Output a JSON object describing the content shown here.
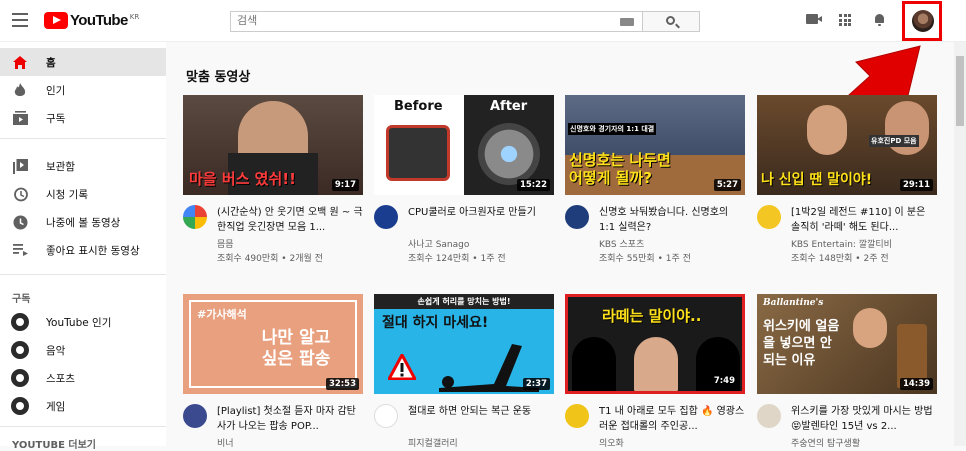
{
  "header": {
    "logo_text": "YouTube",
    "logo_region": "KR",
    "search_placeholder": "검색",
    "menu_icon": "hamburger-menu-icon",
    "icons": [
      "video-camera-icon",
      "apps-grid-icon",
      "notification-bell-icon"
    ]
  },
  "sidebar": {
    "primary": [
      {
        "label": "홈",
        "icon": "home-icon",
        "active": true
      },
      {
        "label": "인기",
        "icon": "trending-flame-icon"
      },
      {
        "label": "구독",
        "icon": "subscriptions-icon"
      }
    ],
    "library": [
      {
        "label": "보관함",
        "icon": "library-icon"
      },
      {
        "label": "시청 기록",
        "icon": "history-icon"
      },
      {
        "label": "나중에 볼 동영상",
        "icon": "watch-later-clock-icon"
      },
      {
        "label": "좋아요 표시한 동영상",
        "icon": "liked-videos-icon"
      }
    ],
    "subscriptions_heading": "구독",
    "subscriptions": [
      {
        "label": "YouTube 인기"
      },
      {
        "label": "음악"
      },
      {
        "label": "스포츠"
      },
      {
        "label": "게임"
      }
    ],
    "more_heading": "YOUTUBE 더보기"
  },
  "main": {
    "section_title": "맞춤 동영상",
    "videos": [
      {
        "thumb_text": "마을 버스 였쉬!!",
        "duration": "9:17",
        "title": "(시간순삭) 안 웃기면 오백 원 ~ 극한직업 웃긴장면 모음 1...",
        "channel": "믐믐",
        "meta": "조회수 490만회 • 2개월 전",
        "thumb_bg": "#3b2a24",
        "avatar_color": "#0f9d58"
      },
      {
        "thumb_text_left": "Before",
        "thumb_text_right": "After",
        "duration": "15:22",
        "title": "CPU쿨러로 아크원자로 만들기",
        "channel": "사나고 Sanago",
        "meta": "조회수 124만회 • 1주 전",
        "thumb_bg": "#ffffff",
        "avatar_color": "#1a3d8f"
      },
      {
        "thumb_text": "신명호는 나두면 어떻게 될까?",
        "thumb_caption": "신명호와 경기자의 1:1 대결",
        "duration": "5:27",
        "title": "신명호 놔둬봤습니다. 신명호의 1:1 실력은?",
        "channel": "KBS 스포츠",
        "meta": "조회수 55만회 • 1주 전",
        "thumb_bg": "#2b3a57",
        "avatar_color": "#1f3d7a"
      },
      {
        "thumb_text": "나 신입 땐 말이야!",
        "thumb_caption": "유호진PD 모음",
        "duration": "29:11",
        "title": "[1박2일 레전드 #110] 이 분은 솔직히 '라떼' 해도 된다...",
        "channel": "KBS Entertain: 깔깔티비",
        "meta": "조회수 148만회 • 2주 전",
        "thumb_bg": "#3a2a1d",
        "avatar_color": "#f3c623"
      },
      {
        "thumb_text": "나만 알고 싶은 팝송",
        "thumb_caption": "#가사해석",
        "duration": "32:53",
        "title": "[Playlist] 첫소절 듣자 마자 감탄사가 나오는 팝송 POP...",
        "channel": "비너",
        "meta": "",
        "thumb_bg": "#e8a07f",
        "avatar_color": "#3b4a8f"
      },
      {
        "thumb_text": "절대 하지 마세요!",
        "thumb_caption": "손쉽게 허리를 망치는 방법!",
        "duration": "2:37",
        "title": "절대로 하면 안되는 복근 운동",
        "channel": "피지컬갤러리",
        "meta": "",
        "thumb_bg": "#28b4e6",
        "avatar_color": "#ffffff"
      },
      {
        "thumb_text": "라떼는 말이야..",
        "duration": "7:49",
        "title": "T1 내 아래로 모두 집합 🔥 영광스러운 접대롤의 주인공...",
        "channel": "의오화",
        "meta": "",
        "thumb_bg": "#1a1a1a",
        "avatar_color": "#f0c419"
      },
      {
        "thumb_text": "위스키에 얼음을 넣으면 안되는 이유",
        "thumb_caption": "Ballantine's",
        "duration": "14:39",
        "title": "위스키를 가장 맛있게 마시는 방법😝발렌타인 15년 vs 2...",
        "channel": "주숭연의 탐구생활",
        "meta": "",
        "thumb_bg": "#6b4d2d",
        "avatar_color": "#e0d6c8"
      }
    ]
  },
  "colors": {
    "brand_red": "#ff0000",
    "annotation_red": "#e00000"
  }
}
